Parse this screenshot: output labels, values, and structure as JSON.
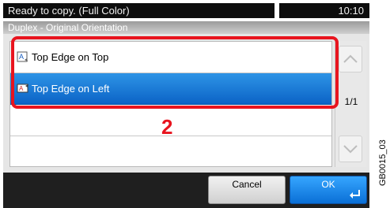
{
  "status": {
    "message": "Ready to copy. (Full Color)",
    "time": "10:10"
  },
  "screen": {
    "title": "Duplex - Original Orientation"
  },
  "list": {
    "items": [
      {
        "label": "Top Edge on Top",
        "icon": "page-orientation-top-icon",
        "selected": false
      },
      {
        "label": "Top Edge on Left",
        "icon": "page-orientation-left-icon",
        "selected": true
      }
    ],
    "page_indicator": "1/1"
  },
  "callout": {
    "number": "2",
    "color": "#e8141e"
  },
  "buttons": {
    "cancel_label": "Cancel",
    "ok_label": "OK"
  },
  "figure_code": "GB0015_03",
  "colors": {
    "selected": "#0b63c6",
    "ok": "#0a6fd6",
    "status_bar": "#0d0d0d"
  }
}
